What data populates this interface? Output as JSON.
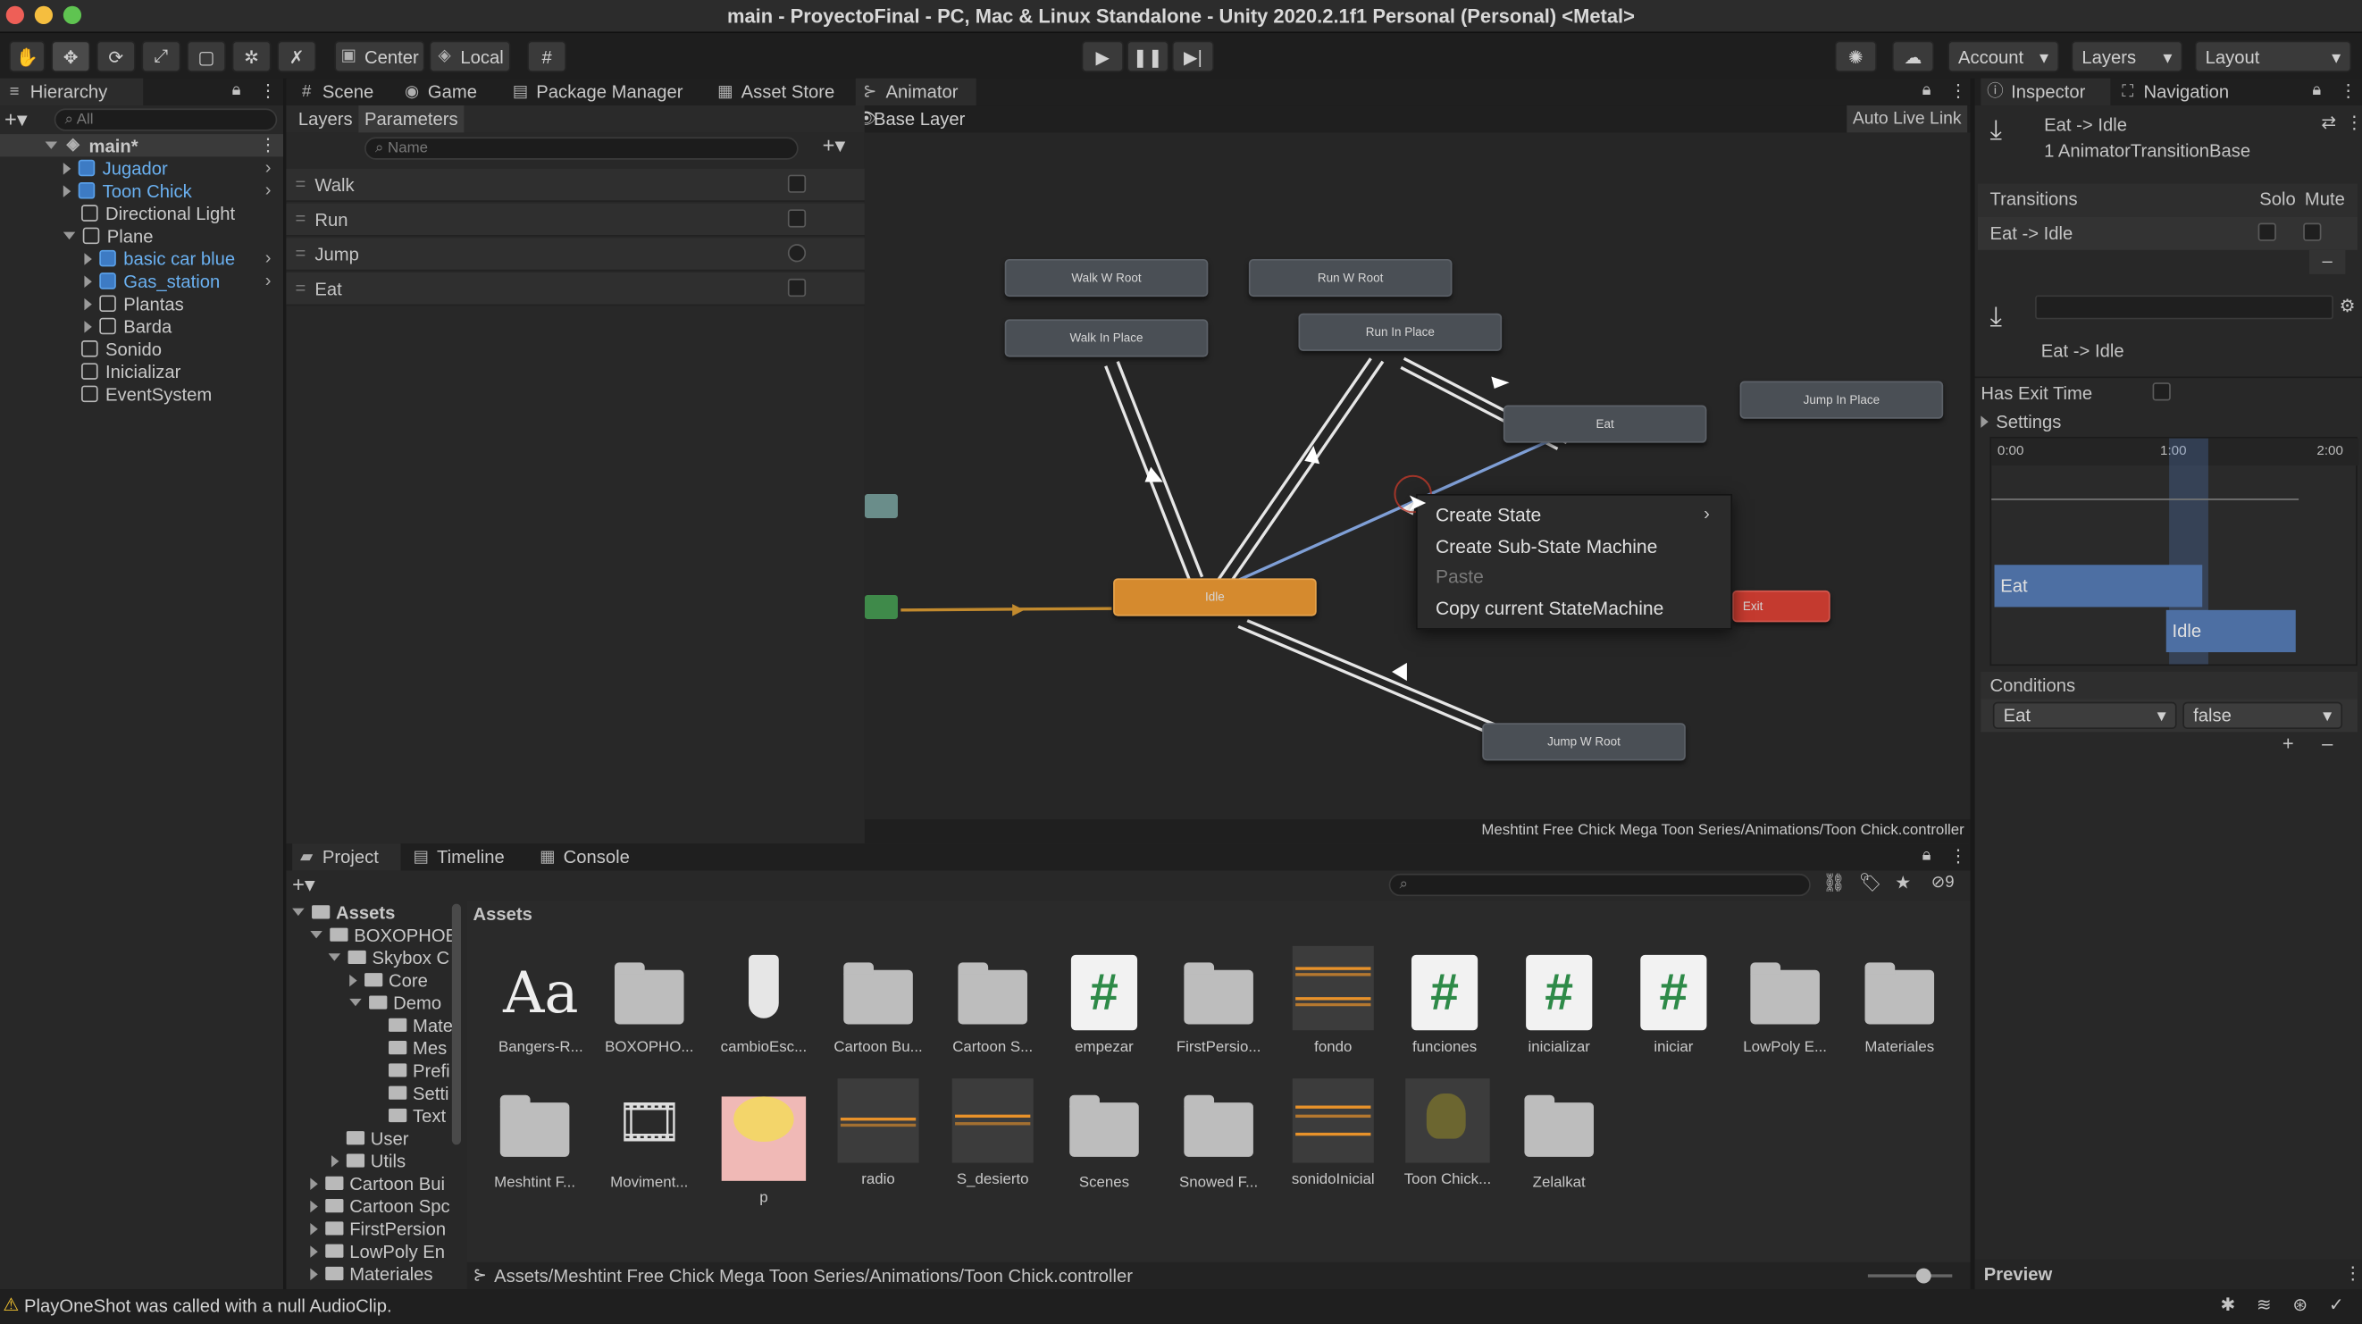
{
  "window": {
    "title": "main - ProyectoFinal - PC, Mac & Linux Standalone - Unity 2020.2.1f1 Personal (Personal) <Metal>"
  },
  "toolbar": {
    "center_label": "Center",
    "local_label": "Local",
    "account_label": "Account",
    "layers_label": "Layers",
    "layout_label": "Layout"
  },
  "hierarchy": {
    "tab": "Hierarchy",
    "search_placeholder": "All",
    "scene": "main*",
    "items": [
      "Jugador",
      "Toon Chick",
      "Directional Light",
      "Plane",
      "basic car blue",
      "Gas_station",
      "Plantas",
      "Barda",
      "Sonido",
      "Inicializar",
      "EventSystem"
    ]
  },
  "center_tabs": {
    "scene": "Scene",
    "game": "Game",
    "package_manager": "Package Manager",
    "asset_store": "Asset Store",
    "animator": "Animator"
  },
  "animator": {
    "layers_tab": "Layers",
    "parameters_tab": "Parameters",
    "name_placeholder": "Name",
    "base_layer": "Base Layer",
    "auto_live_link": "Auto Live Link",
    "parameters": [
      "Walk",
      "Run",
      "Jump",
      "Eat"
    ],
    "states": {
      "walk_w_root": "Walk W Root",
      "run_w_root": "Run W Root",
      "walk_in_place": "Walk In Place",
      "run_in_place": "Run In Place",
      "eat": "Eat",
      "jump_in_place": "Jump In Place",
      "idle": "Idle",
      "exit": "Exit",
      "jump_w_root": "Jump W Root"
    },
    "controller_path": "Meshtint Free Chick Mega Toon Series/Animations/Toon Chick.controller"
  },
  "context_menu": {
    "create_state": "Create State",
    "create_sub_state_machine": "Create Sub-State Machine",
    "paste": "Paste",
    "copy_state_machine": "Copy current StateMachine"
  },
  "inspector": {
    "tab": "Inspector",
    "nav_tab": "Navigation",
    "transition_title": "Eat -> Idle",
    "transition_subtitle": "1 AnimatorTransitionBase",
    "transitions_label": "Transitions",
    "solo": "Solo",
    "mute": "Mute",
    "transition_item": "Eat -> Idle",
    "transition_name": "Eat -> Idle",
    "has_exit_time": "Has Exit Time",
    "settings": "Settings",
    "timeline_start": "0:00",
    "timeline_mid": "1:00",
    "timeline_end": "2:00",
    "track_eat": "Eat",
    "track_idle": "Idle",
    "conditions": "Conditions",
    "condition_param": "Eat",
    "condition_value": "false",
    "preview": "Preview"
  },
  "project": {
    "tabs": {
      "project": "Project",
      "timeline": "Timeline",
      "console": "Console"
    },
    "hidden_count": "9",
    "tree": [
      "Assets",
      "BOXOPHOB",
      "Skybox C",
      "Core",
      "Demo",
      "Mate",
      "Mes",
      "Prefi",
      "Setti",
      "Text",
      "User",
      "Utils",
      "Cartoon Bui",
      "Cartoon Spc",
      "FirstPersion",
      "LowPoly En",
      "Materiales"
    ],
    "header": "Assets",
    "assets_row1": [
      "Bangers-R...",
      "BOXOPHO...",
      "cambioEsc...",
      "Cartoon Bu...",
      "Cartoon S...",
      "empezar",
      "FirstPersio...",
      "fondo",
      "funciones",
      "inicializar",
      "iniciar",
      "LowPoly E...",
      "Materiales"
    ],
    "assets_row2": [
      "Meshtint F...",
      "Moviment...",
      "p",
      "radio",
      "S_desierto",
      "Scenes",
      "Snowed F...",
      "sonidoInicial",
      "Toon Chick...",
      "Zelalkat"
    ],
    "path": "Assets/Meshtint Free Chick Mega Toon Series/Animations/Toon Chick.controller"
  },
  "status": {
    "message": "PlayOneShot was called with a null AudioClip."
  }
}
